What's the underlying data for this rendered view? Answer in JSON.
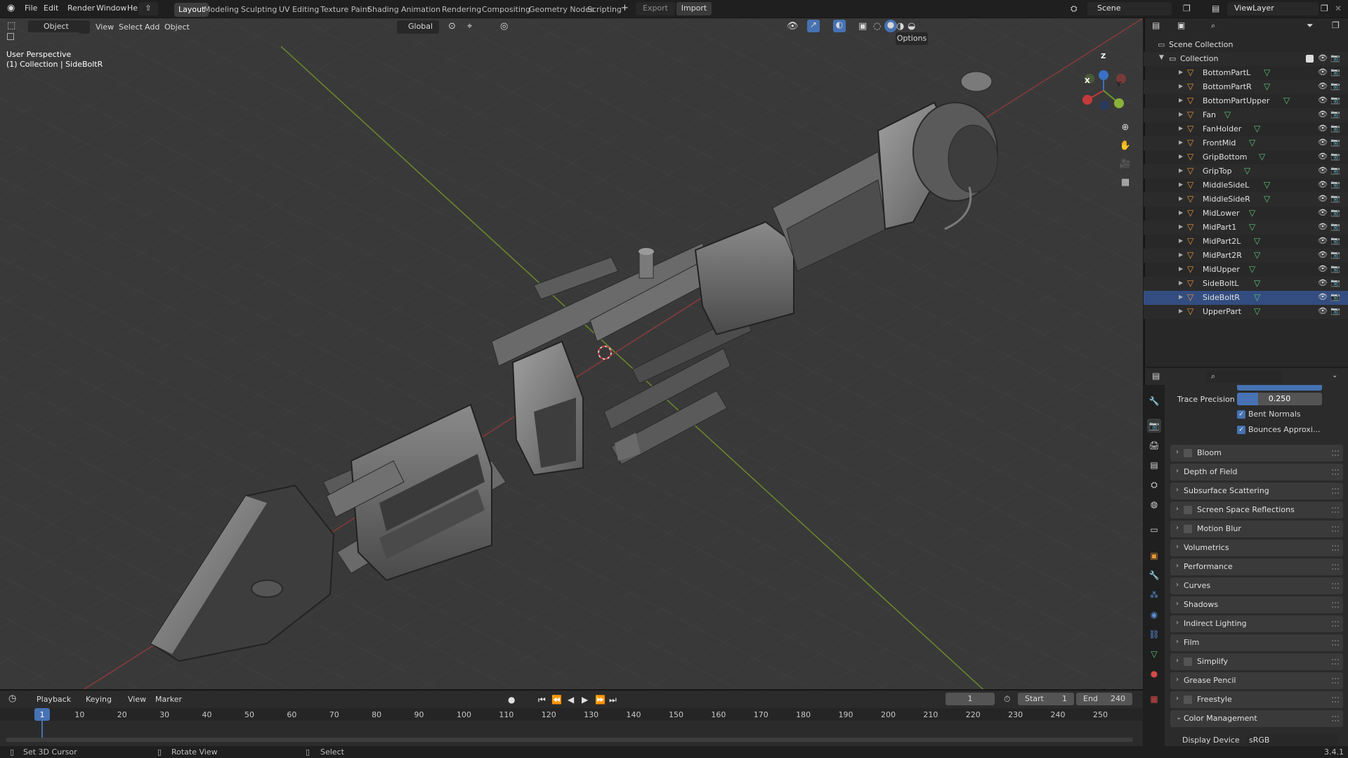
{
  "menu": [
    "File",
    "Edit",
    "Render",
    "Window",
    "Help"
  ],
  "workspaces": [
    "Layout",
    "Modeling",
    "Sculpting",
    "UV Editing",
    "Texture Paint",
    "Shading",
    "Animation",
    "Rendering",
    "Compositing",
    "Geometry Nodes",
    "Scripting"
  ],
  "active_workspace": "Layout",
  "top_buttons": {
    "export": "Export",
    "import": "Import",
    "scene": "Scene",
    "view_layer": "ViewLayer",
    "add_workspace": "+"
  },
  "viewport_header": {
    "mode": "Object Mode",
    "view": "View",
    "select": "Select",
    "add": "Add",
    "object": "Object",
    "orientation": "Global",
    "options": "Options"
  },
  "viewport_overlay": {
    "perspective": "User Perspective",
    "context": "(1) Collection | SideBoltR"
  },
  "gizmo": {
    "x": "X",
    "y": "Y",
    "z": "Z"
  },
  "outliner": {
    "scene_collection": "Scene Collection",
    "collection": "Collection",
    "objects": [
      "BottomPartL",
      "BottomPartR",
      "BottomPartUpper",
      "Fan",
      "FanHolder",
      "FrontMid",
      "GripBottom",
      "GripTop",
      "MiddleSideL",
      "MiddleSideR",
      "MidLower",
      "MidPart1",
      "MidPart2L",
      "MidPart2R",
      "MidUpper",
      "SideBoltL",
      "SideBoltR",
      "UpperPart"
    ],
    "selected": "SideBoltR"
  },
  "properties": {
    "trace_precision_label": "Trace Precision",
    "trace_precision_value": "0.250",
    "bent_normals": "Bent Normals",
    "bounces_approx": "Bounces Approxi...",
    "panels": [
      {
        "label": "Bloom",
        "checkbox": true
      },
      {
        "label": "Depth of Field",
        "checkbox": false
      },
      {
        "label": "Subsurface Scattering",
        "checkbox": false
      },
      {
        "label": "Screen Space Reflections",
        "checkbox": true
      },
      {
        "label": "Motion Blur",
        "checkbox": true
      },
      {
        "label": "Volumetrics",
        "checkbox": false
      },
      {
        "label": "Performance",
        "checkbox": false
      },
      {
        "label": "Curves",
        "checkbox": false
      },
      {
        "label": "Shadows",
        "checkbox": false
      },
      {
        "label": "Indirect Lighting",
        "checkbox": false
      },
      {
        "label": "Film",
        "checkbox": false
      },
      {
        "label": "Simplify",
        "checkbox": true
      },
      {
        "label": "Grease Pencil",
        "checkbox": false
      },
      {
        "label": "Freestyle",
        "checkbox": true
      },
      {
        "label": "Color Management",
        "checkbox": false,
        "expanded": true
      }
    ],
    "display_device_label": "Display Device",
    "display_device_value": "sRGB"
  },
  "timeline": {
    "playback": "Playback",
    "keying": "Keying",
    "view": "View",
    "marker": "Marker",
    "current_frame": "1",
    "start_label": "Start",
    "start": "1",
    "end_label": "End",
    "end": "240",
    "ticks": [
      "1",
      "10",
      "20",
      "30",
      "40",
      "50",
      "60",
      "70",
      "80",
      "90",
      "100",
      "110",
      "120",
      "130",
      "140",
      "150",
      "160",
      "170",
      "180",
      "190",
      "200",
      "210",
      "220",
      "230",
      "240",
      "250"
    ]
  },
  "status": {
    "left": "Set 3D Cursor",
    "middle": "Rotate View",
    "right": "Select",
    "version": "3.4.1"
  },
  "colors": {
    "accent": "#4772b3",
    "selection": "#334d80",
    "object_icon": "#e8973a",
    "mesh_icon": "#5ec27a"
  }
}
